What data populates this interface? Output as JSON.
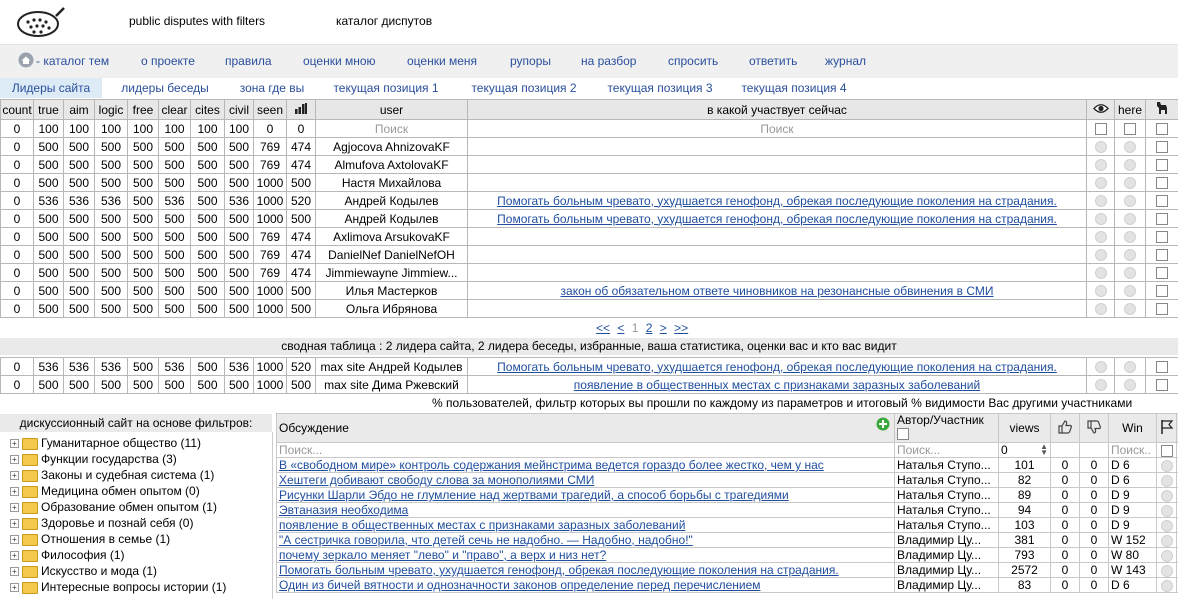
{
  "top": {
    "link1": "public disputes with filters",
    "link2": "каталог диспутов"
  },
  "menu": [
    "- каталог тем",
    "о проекте",
    "правила",
    "оценки мною",
    "оценки меня",
    "рупоры",
    "на разбор",
    "спросить",
    "ответить",
    "журнал"
  ],
  "tabs": [
    "Лидеры сайта",
    "лидеры беседы",
    "зона где вы",
    "текущая позиция 1",
    "текущая позиция 2",
    "текущая позиция 3",
    "текущая позиция 4"
  ],
  "grid": {
    "headers": [
      "count",
      "true",
      "aim",
      "logic",
      "free",
      "clear",
      "cites",
      "civil",
      "seen",
      "",
      "user",
      "в какой участвует сейчас",
      "",
      "here",
      ""
    ],
    "filter": {
      "values": [
        "0",
        "100",
        "100",
        "100",
        "100",
        "100",
        "100",
        "100",
        "0",
        "0"
      ],
      "user_placeholder": "Поиск",
      "topic_placeholder": "Поиск"
    },
    "rows": [
      {
        "v": [
          "0",
          "500",
          "500",
          "500",
          "500",
          "500",
          "500",
          "500",
          "769",
          "474"
        ],
        "user": "Agjocova AhnizovaKF",
        "topic": ""
      },
      {
        "v": [
          "0",
          "500",
          "500",
          "500",
          "500",
          "500",
          "500",
          "500",
          "769",
          "474"
        ],
        "user": "Almufova AxtolovaKF",
        "topic": ""
      },
      {
        "v": [
          "0",
          "500",
          "500",
          "500",
          "500",
          "500",
          "500",
          "500",
          "1000",
          "500"
        ],
        "user": "Настя Михайлова",
        "topic": ""
      },
      {
        "v": [
          "0",
          "536",
          "536",
          "536",
          "500",
          "536",
          "500",
          "536",
          "1000",
          "520"
        ],
        "user": "Андрей Кодылев",
        "topic": "Помогать больным чревато, ухудшается генофонд, обрекая последующие поколения на страдания."
      },
      {
        "v": [
          "0",
          "500",
          "500",
          "500",
          "500",
          "500",
          "500",
          "500",
          "1000",
          "500"
        ],
        "user": "Андрей Кодылев",
        "topic": "Помогать больным чревато, ухудшается генофонд, обрекая последующие поколения на страдания."
      },
      {
        "v": [
          "0",
          "500",
          "500",
          "500",
          "500",
          "500",
          "500",
          "500",
          "769",
          "474"
        ],
        "user": "Axlimova ArsukovaKF",
        "topic": ""
      },
      {
        "v": [
          "0",
          "500",
          "500",
          "500",
          "500",
          "500",
          "500",
          "500",
          "769",
          "474"
        ],
        "user": "DanielNef DanielNefOH",
        "topic": ""
      },
      {
        "v": [
          "0",
          "500",
          "500",
          "500",
          "500",
          "500",
          "500",
          "500",
          "769",
          "474"
        ],
        "user": "Jimmiewayne Jimmiew...",
        "topic": ""
      },
      {
        "v": [
          "0",
          "500",
          "500",
          "500",
          "500",
          "500",
          "500",
          "500",
          "1000",
          "500"
        ],
        "user": "Илья Мастерков",
        "topic": "закон об обязательном ответе чиновников на резонансные обвинения в СМИ"
      },
      {
        "v": [
          "0",
          "500",
          "500",
          "500",
          "500",
          "500",
          "500",
          "500",
          "1000",
          "500"
        ],
        "user": "Ольга Ибрянова",
        "topic": ""
      }
    ]
  },
  "pager": [
    "<<",
    "<",
    "1",
    "2",
    ">",
    ">>"
  ],
  "summary": {
    "title": "сводная таблица : 2 лидера сайта, 2 лидера беседы, избранные, ваша статистика, оценки вас и кто вас видит",
    "rows": [
      {
        "v": [
          "0",
          "536",
          "536",
          "536",
          "500",
          "536",
          "500",
          "536",
          "1000",
          "520"
        ],
        "user": "max site Андрей Кодылев",
        "topic": "Помогать больным чревато, ухудшается генофонд, обрекая последующие поколения на страдания."
      },
      {
        "v": [
          "0",
          "500",
          "500",
          "500",
          "500",
          "500",
          "500",
          "500",
          "1000",
          "500"
        ],
        "user": "max site Дима Ржевский",
        "topic": "появление в общественных местах с признаками заразных заболеваний"
      }
    ],
    "note": "% пользователей, фильтр которых вы прошли по каждому из параметров и итоговый % видимости Вас другими участниками"
  },
  "tree": {
    "title": "дискуссионный сайт на основе фильтров:",
    "items": [
      "Гуманитарное общество (11)",
      "Функции государства (3)",
      "Законы и судебная система (1)",
      "Медицина обмен опытом (0)",
      "Образование обмен опытом (1)",
      "Здоровье и познай себя (0)",
      "Отношения в семье (1)",
      "Философия (1)",
      "Искусство и мода (1)",
      "Интересные вопросы истории (1)"
    ]
  },
  "disc": {
    "h_topic": "Обсуждение",
    "h_author": "Автор/Участник",
    "h_views": "views",
    "h_win": "Win",
    "search": "Поиск...",
    "views_filter": "0",
    "win_search": "Поиск..",
    "rows": [
      {
        "t": "В «свободном мире» контроль содержания мейнстрима ведется гораздо более жестко, чем у нас",
        "a": "Наталья Ступо...",
        "v": "101",
        "l": "0",
        "d": "0",
        "w": "D 6"
      },
      {
        "t": "Хештеги добивают свободу слова за монополиями СМИ",
        "a": "Наталья Ступо...",
        "v": "82",
        "l": "0",
        "d": "0",
        "w": "D 6"
      },
      {
        "t": "Рисунки Шарли Эбдо не глумление над жертвами трагедий, а способ борьбы с трагедиями",
        "a": "Наталья Ступо...",
        "v": "89",
        "l": "0",
        "d": "0",
        "w": "D 9"
      },
      {
        "t": "Эвтаназия необходима",
        "a": "Наталья Ступо...",
        "v": "94",
        "l": "0",
        "d": "0",
        "w": "D 9"
      },
      {
        "t": "появление в общественных местах с признаками заразных заболеваний",
        "a": "Наталья Ступо...",
        "v": "103",
        "l": "0",
        "d": "0",
        "w": "D 9"
      },
      {
        "t": "\"А сестричка говорила, что детей сечь не надобно. — Надобно, надобно!\"",
        "a": "Владимир Цу...",
        "v": "381",
        "l": "0",
        "d": "0",
        "w": "W 152"
      },
      {
        "t": "почему зеркало меняет \"лево\" и \"право\", а верх и низ нет?",
        "a": "Владимир Цу...",
        "v": "793",
        "l": "0",
        "d": "0",
        "w": "W 80"
      },
      {
        "t": "Помогать больным чревато, ухудшается генофонд, обрекая последующие поколения на страдания.",
        "a": "Владимир Цу...",
        "v": "2572",
        "l": "0",
        "d": "0",
        "w": "W 143"
      },
      {
        "t": "Один из бичей вятности и однозначности законов определение перед перечислением",
        "a": "Владимир Цу...",
        "v": "83",
        "l": "0",
        "d": "0",
        "w": "D 6"
      }
    ]
  },
  "colors": {
    "link": "#1f4e9e",
    "tab_active": "#ddebf7",
    "header_bg": "#e7e7e7",
    "folder": "#f2c94c"
  }
}
